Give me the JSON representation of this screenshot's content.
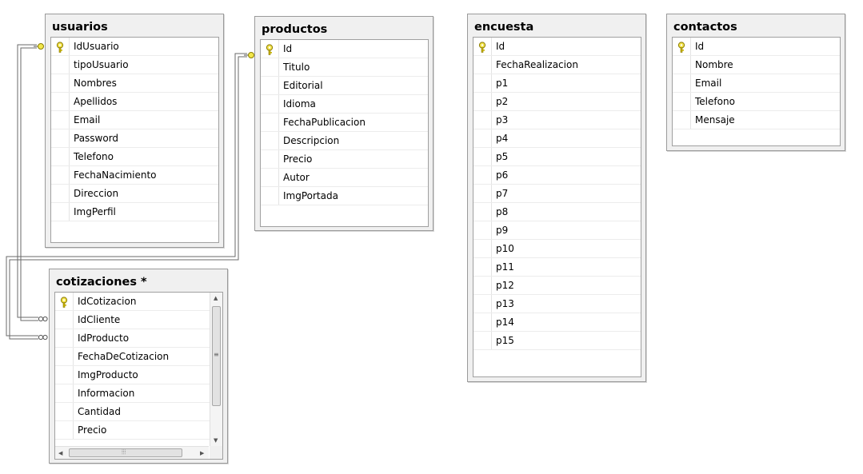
{
  "tables": {
    "usuarios": {
      "title": "usuarios",
      "columns": [
        "IdUsuario",
        "tipoUsuario",
        "Nombres",
        "Apellidos",
        "Email",
        "Password",
        "Telefono",
        "FechaNacimiento",
        "Direccion",
        "ImgPerfil"
      ]
    },
    "productos": {
      "title": "productos",
      "columns": [
        "Id",
        "Titulo",
        "Editorial",
        "Idioma",
        "FechaPublicacion",
        "Descripcion",
        "Precio",
        "Autor",
        "ImgPortada"
      ]
    },
    "encuesta": {
      "title": "encuesta",
      "columns": [
        "Id",
        "FechaRealizacion",
        "p1",
        "p2",
        "p3",
        "p4",
        "p5",
        "p6",
        "p7",
        "p8",
        "p9",
        "p10",
        "p11",
        "p12",
        "p13",
        "p14",
        "p15"
      ]
    },
    "contactos": {
      "title": "contactos",
      "columns": [
        "Id",
        "Nombre",
        "Email",
        "Telefono",
        "Mensaje"
      ]
    },
    "cotizaciones": {
      "title": "cotizaciones *",
      "columns": [
        "IdCotizacion",
        "IdCliente",
        "IdProducto",
        "FechaDeCotizacion",
        "ImgProducto",
        "Informacion",
        "Cantidad",
        "Precio"
      ]
    }
  },
  "primary_key_icon": "key-icon",
  "relationships": [
    {
      "from": "usuarios.IdUsuario",
      "to": "cotizaciones.IdCliente",
      "one_end_icon": "key-connector-icon",
      "many_end_icon": "infinity-icon"
    },
    {
      "from": "productos.Id",
      "to": "cotizaciones.IdProducto",
      "one_end_icon": "key-connector-icon",
      "many_end_icon": "infinity-icon"
    }
  ],
  "colors": {
    "table_frame": "#f0f0f0",
    "border": "#9a9a9a",
    "key_icon": "#c8b400",
    "line": "#6a6a6a"
  }
}
